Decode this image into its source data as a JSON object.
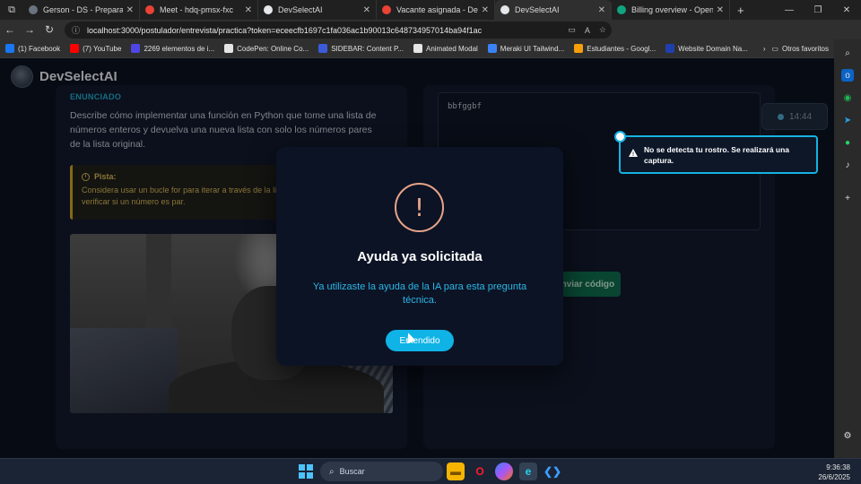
{
  "browser": {
    "tabs": [
      {
        "title": "Gerson - DS - Preparación p",
        "color": "#6b7280",
        "active": false
      },
      {
        "title": "Meet - hdq-pmsx-fxc",
        "color": "#ea4335",
        "active": false
      },
      {
        "title": "DevSelectAI",
        "color": "#e5e7eb",
        "active": false
      },
      {
        "title": "Vacante asignada - Dev",
        "color": "#ea4335",
        "active": false
      },
      {
        "title": "DevSelectAI",
        "color": "#e5e7eb",
        "active": true
      },
      {
        "title": "Billing overview - OpenAI A",
        "color": "#10a37f",
        "active": false
      }
    ],
    "url": "localhost:3000/postulador/entrevista/practica?token=eceecfb1697c1fa036ac1b90013c648734957014ba94f1ac",
    "bookmarks": [
      {
        "label": "(1) Facebook",
        "color": "#1877f2"
      },
      {
        "label": "(7) YouTube",
        "color": "#ff0000"
      },
      {
        "label": "2269 elementos de i...",
        "color": "#4f46e5"
      },
      {
        "label": "CodePen: Online Co...",
        "color": "#e5e5e5"
      },
      {
        "label": "SIDEBAR: Content P...",
        "color": "#3b5bdb"
      },
      {
        "label": "Animated Modal",
        "color": "#e5e5e5"
      },
      {
        "label": "Meraki UI Tailwind...",
        "color": "#3b82f6"
      },
      {
        "label": "Estudiantes - Googl...",
        "color": "#f59e0b"
      },
      {
        "label": "Website Domain Na...",
        "color": "#1e40af"
      }
    ],
    "other_bookmarks": "Otros favoritos"
  },
  "app": {
    "name": "DevSelectAI",
    "statement_label": "ENUNCIADO",
    "statement": "Describe cómo implementar una función en Python que tome una lista de números enteros y devuelva una nueva lista con solo los números pares de la lista original.",
    "hint_title": "Pista:",
    "hint_text": "Considera usar un bucle for para iterar a través de la lista y el operador % para verificar si un número es par.",
    "code_value": "bbfggbf",
    "send_button": "Enviar código",
    "timer": "14:44"
  },
  "modal": {
    "title": "Ayuda ya solicitada",
    "message": "Ya utilizaste la ayuda de la IA para esta pregunta técnica.",
    "button": "Entendido"
  },
  "toast": {
    "message": "No se detecta tu rostro. Se realizará una captura."
  },
  "taskbar": {
    "search_placeholder": "Buscar",
    "time": "9:36:38",
    "date": "26/6/2025"
  },
  "colors": {
    "accent": "#0fb3e6",
    "warning": "#e8a488",
    "hint": "#d6b556"
  }
}
